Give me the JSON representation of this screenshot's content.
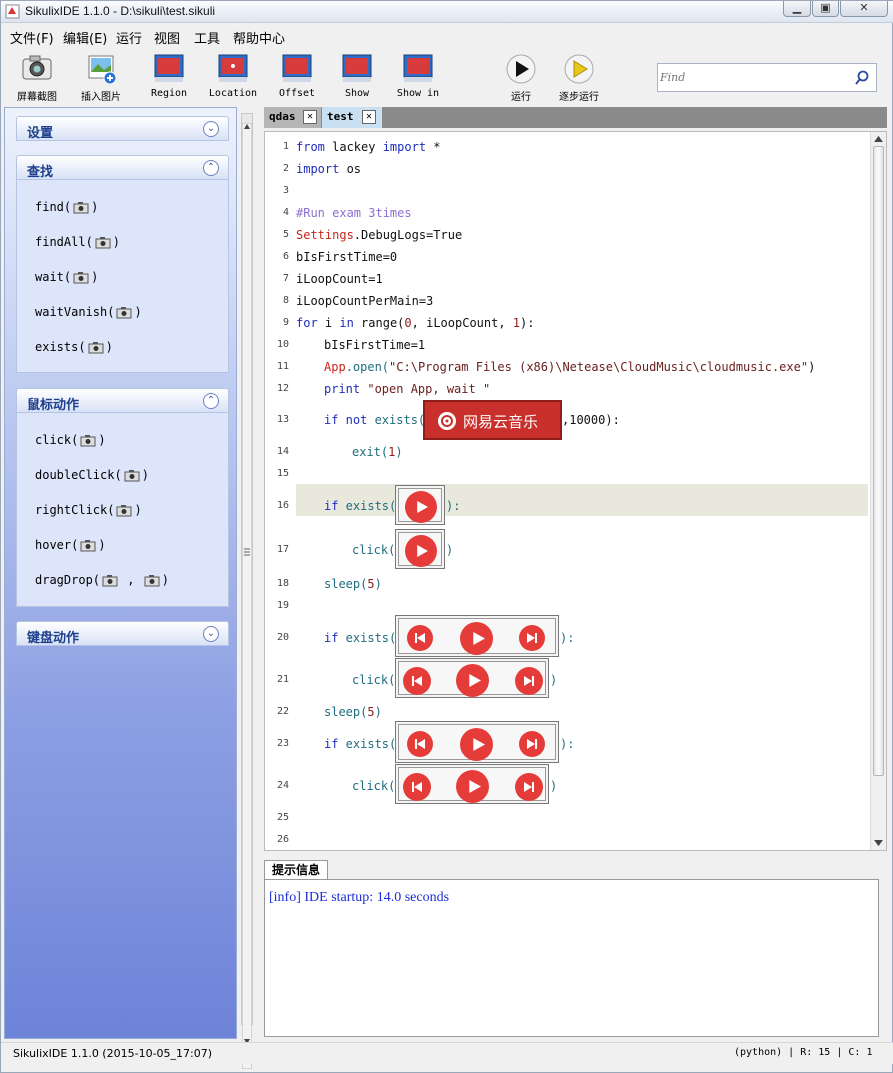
{
  "window": {
    "title": "SikulixIDE 1.1.0 - D:\\sikuli\\test.sikuli"
  },
  "menu": [
    "文件(F)",
    "编辑(E)",
    "运行",
    "视图",
    "工具",
    "帮助中心"
  ],
  "toolbar": {
    "screenshot": "屏幕截图",
    "insert_image": "插入图片",
    "region": "Region",
    "location": "Location",
    "offset": "Offset",
    "show": "Show",
    "show_in": "Show in",
    "run": "运行",
    "run_slow": "逐步运行"
  },
  "search": {
    "placeholder": "Find"
  },
  "sidebar": {
    "settings": "设置",
    "find": {
      "title": "查找",
      "items": [
        "find(",
        "findAll(",
        "wait(",
        "waitVanish(",
        "exists("
      ]
    },
    "mouse": {
      "title": "鼠标动作",
      "items": [
        "click(",
        "doubleClick(",
        "rightClick(",
        "hover(",
        "dragDrop("
      ]
    },
    "keyboard": "键盘动作",
    "close_paren": ")",
    "comma": ","
  },
  "tabs": [
    "qdas",
    "test"
  ],
  "code": {
    "line_numbers": [
      "1",
      "2",
      "3",
      "4",
      "5",
      "6",
      "7",
      "8",
      "9",
      "10",
      "11",
      "12",
      "13",
      "14",
      "15",
      "16",
      "17",
      "18",
      "19",
      "20",
      "21",
      "22",
      "23",
      "24",
      "25",
      "26"
    ],
    "l1a": "from",
    "l1b": " lackey ",
    "l1c": "import",
    "l1d": " *",
    "l2a": "import",
    "l2b": " os",
    "l4": "#Run exam 3times",
    "l5a": "Settings",
    "l5b": ".DebugLogs=True",
    "l6": "bIsFirstTime=0",
    "l7": "iLoopCount=1",
    "l8": "iLoopCountPerMain=3",
    "l9a": "for",
    "l9b": " i ",
    "l9c": "in",
    "l9d": " range(",
    "l9e": "0",
    "l9f": ", iLoopCount, ",
    "l9g": "1",
    "l9h": "):",
    "l10": "bIsFirstTime=1",
    "l11a": "App",
    "l11b": ".open(",
    "l11c": "\"C:\\Program Files (x86)\\Netease\\CloudMusic\\cloudmusic.exe\"",
    "l11d": ")",
    "l12a": "print",
    "l12b": " \"open App, wait \"",
    "l13a": "if not",
    "l13b": " exists(",
    "l13c": ",10000):",
    "netease_logo": "网易云音乐",
    "l14a": "exit(",
    "l14b": "1",
    "l14c": ")",
    "l16a": "if",
    "l16b": " exists(",
    "l16c": "):",
    "l17a": "click(",
    "l17b": ")",
    "l18a": "sleep(",
    "l18b": "5",
    "l18c": ")",
    "l20a": "if",
    "l20b": " exists(",
    "l20c": "):",
    "l21a": "click(",
    "l21b": ")",
    "l22a": "sleep(",
    "l22b": "5",
    "l22c": ")",
    "l23a": "if",
    "l23b": " exists(",
    "l23c": "):",
    "l24a": "click(",
    "l24b": ")"
  },
  "messages": {
    "tab": "提示信息",
    "text": "[info] IDE startup: 14.0 seconds"
  },
  "status": {
    "left": "SikulixIDE 1.1.0 (2015-10-05_17:07)",
    "right": "(python) | R: 15 | C: 1"
  },
  "colors": {
    "keyword": "#1e2ebc",
    "comment": "#8a6fd1",
    "netease_red": "#c9302c",
    "play_red": "#e53c3a",
    "info_text": "#1c2ed6"
  }
}
